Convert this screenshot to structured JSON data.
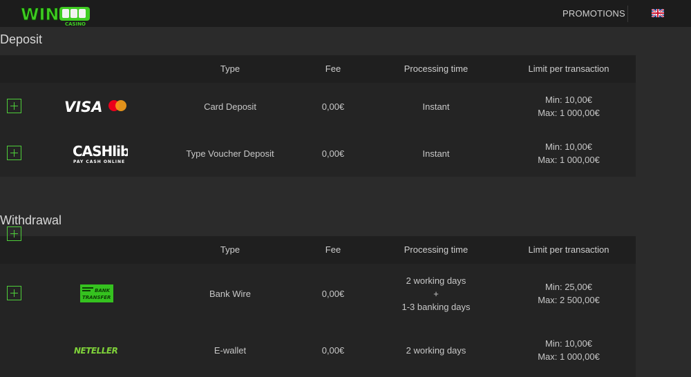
{
  "header": {
    "logo_text": "WIN",
    "logo_sub": "CASINO",
    "promotions_label": "PROMOTIONS",
    "language_flag": "uk-flag-icon"
  },
  "columns": {
    "type": "Type",
    "fee": "Fee",
    "processing": "Processing time",
    "limit": "Limit per transaction"
  },
  "deposit": {
    "title": "Deposit",
    "rows": [
      {
        "method": "VISA / Mastercard",
        "type": "Card Deposit",
        "fee": "0,00€",
        "processing": "Instant",
        "min": "Min: 10,00€",
        "max": "Max: 1 000,00€"
      },
      {
        "method": "CASHlib",
        "type": "Type Voucher Deposit",
        "fee": "0,00€",
        "processing": "Instant",
        "min": "Min: 10,00€",
        "max": "Max: 1 000,00€"
      }
    ]
  },
  "withdrawal": {
    "title": "Withdrawal",
    "rows": [
      {
        "method": "Bank Transfer",
        "type": "Bank Wire",
        "fee": "0,00€",
        "processing_lines": [
          "2 working days",
          "+",
          "1-3 banking days"
        ],
        "min": "Min: 25,00€",
        "max": "Max: 2 500,00€"
      },
      {
        "method": "NETELLER",
        "type": "E-wallet",
        "fee": "0,00€",
        "processing": "2 working days",
        "min": "Min: 10,00€",
        "max": "Max: 1 000,00€"
      }
    ]
  },
  "logos": {
    "visa_text": "VISA",
    "cashlib_main": "CASHlib",
    "cashlib_sub": "PAY CASH ONLINE",
    "bank_line1": "BANK",
    "bank_line2": "TRANSFER",
    "neteller_text": "NETELLER"
  },
  "colors": {
    "accent_green": "#4fcf3a",
    "background": "#2b2b2b",
    "row_bg": "#242424",
    "header_bg": "#1f1f1f"
  }
}
